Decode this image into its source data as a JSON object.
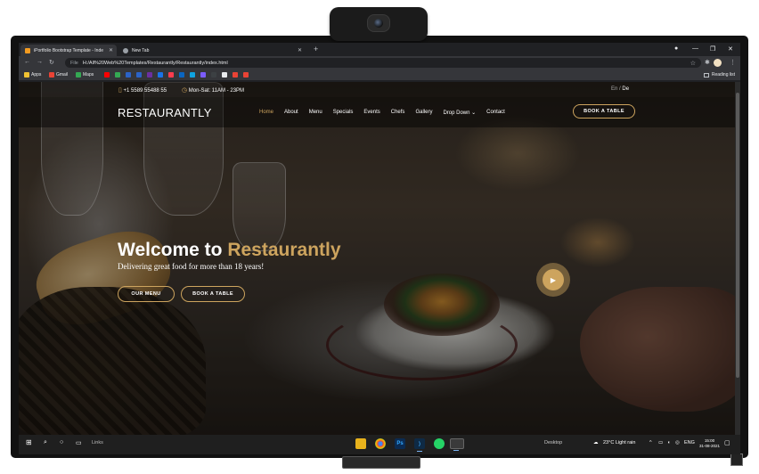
{
  "browser": {
    "tabs": [
      {
        "title": "iPortfolio Bootstrap Template - Inde",
        "favicon_color": "#f29b21"
      },
      {
        "title": "New Tab",
        "favicon_color": "#9aa0a6"
      }
    ],
    "new_tab_icon": "+",
    "url_prefix": "File",
    "url": "H:/All%20Web%20Templates/Restaurantly/Restaurantly/index.html",
    "bookmarks": [
      {
        "label": "Apps",
        "color": "#f1c232"
      },
      {
        "label": "Gmail",
        "color": "#ea4335"
      },
      {
        "label": "Maps",
        "color": "#34a853"
      }
    ],
    "bookmark_icons": [
      "#ff0000",
      "#34a853",
      "#2b63c7",
      "#2b63c7",
      "#6b2fa0",
      "#1a73e8",
      "#ff3d4e",
      "#0a66c2",
      "#0fa3e0",
      "#7b5cff",
      "#3c4043",
      "#e8eaed",
      "#ea4335",
      "#ea4335"
    ],
    "reading_list": "Reading list"
  },
  "site": {
    "phone": "+1 5589 55488 55",
    "hours": "Mon-Sat: 11AM - 23PM",
    "lang_en": "En",
    "lang_separator": "/",
    "lang_de": "De",
    "logo": "RESTAURANTLY",
    "nav": [
      {
        "label": "Home",
        "active": true
      },
      {
        "label": "About"
      },
      {
        "label": "Menu"
      },
      {
        "label": "Specials"
      },
      {
        "label": "Events"
      },
      {
        "label": "Chefs"
      },
      {
        "label": "Gallery"
      },
      {
        "label": "Drop Down ⌄"
      },
      {
        "label": "Contact"
      }
    ],
    "book_table": "BOOK A TABLE",
    "hero_title_prefix": "Welcome to ",
    "hero_title_brand": "Restaurantly",
    "hero_subtitle": "Delivering great food for more than 18 years!",
    "btn_menu": "OUR MENU",
    "btn_book": "BOOK A TABLE",
    "accent": "#cda45e"
  },
  "taskbar": {
    "links_label": "Links",
    "desktop_label": "Desktop",
    "weather": "23°C  Light rain",
    "lang": "ENG",
    "time": "15:00",
    "date": "31-08-2021"
  }
}
